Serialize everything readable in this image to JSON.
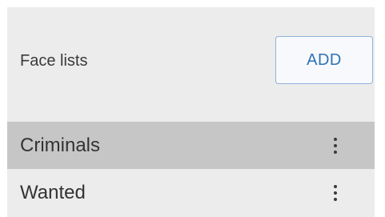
{
  "face_lists": {
    "title": "Face lists",
    "add_label": "ADD",
    "items": [
      {
        "label": "Criminals",
        "selected": true
      },
      {
        "label": "Wanted",
        "selected": false
      }
    ]
  }
}
